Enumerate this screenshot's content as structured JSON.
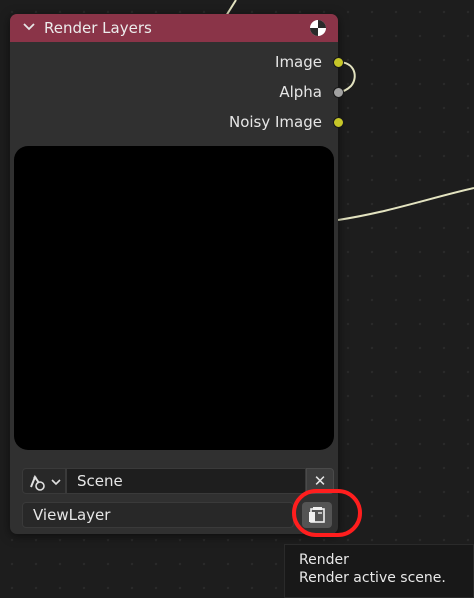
{
  "node": {
    "title": "Render Layers",
    "outputs": [
      {
        "label": "Image",
        "socket_color": "#c7c729"
      },
      {
        "label": "Alpha",
        "socket_color": "#a1a1a1"
      },
      {
        "label": "Noisy Image",
        "socket_color": "#c7c729"
      }
    ],
    "scene_value": "Scene",
    "clear_label": "✕",
    "layer_value": "ViewLayer",
    "header_color": "#8a3448",
    "icons": {
      "collapse": "chevron-down-icon",
      "node_type": "render-layer-icon",
      "scene_type": "scene-type-icon",
      "render": "render-icon"
    }
  },
  "tooltip": {
    "title": "Render",
    "description": "Render active scene."
  },
  "colors": {
    "wire": "#e3e3c0",
    "highlight": "#ff1e1e"
  }
}
